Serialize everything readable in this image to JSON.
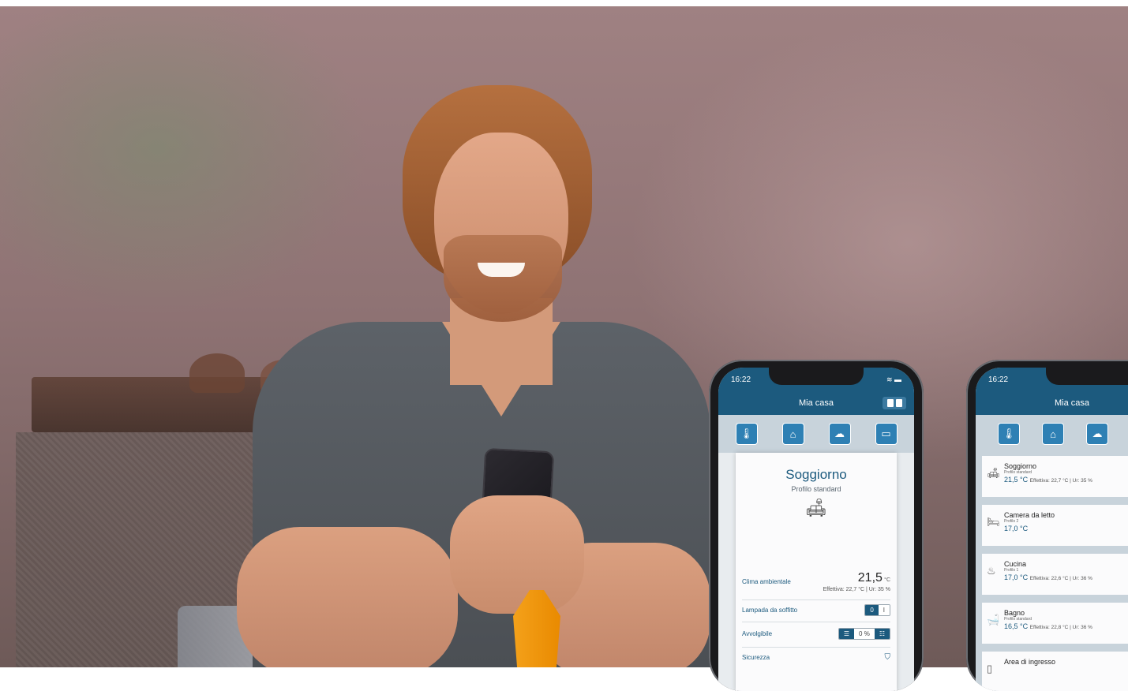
{
  "status_time": "16:22",
  "status_icons": "≋ ▬",
  "phone1": {
    "nav_title": "Mia casa",
    "room_title": "Soggiorno",
    "room_profile": "Profilo standard",
    "rows": {
      "clima_label": "Clima ambientale",
      "clima_value": "21,5",
      "clima_unit": "°C",
      "clima_effective": "Effettiva: 22,7 °C | Ur: 35 %",
      "lampada_label": "Lampada da soffitto",
      "lampada_off": "0",
      "lampada_on": "I",
      "avvolgibile_label": "Avvolgibile",
      "avvolgibile_value": "0 %",
      "sicurezza_label": "Sicurezza"
    }
  },
  "phone2": {
    "nav_title": "Mia casa",
    "rooms": [
      {
        "name": "Soggiorno",
        "profile": "Profilo standard",
        "temp": "21,5 °C",
        "effective": "Effettiva: 22,7 °C | Ur: 35 %"
      },
      {
        "name": "Camera da letto",
        "profile": "Profilo 2",
        "temp": "17,0 °C",
        "effective": ""
      },
      {
        "name": "Cucina",
        "profile": "Profilo 1",
        "temp": "17,0 °C",
        "effective": "Effettiva: 22,6 °C | Ur: 36 %"
      },
      {
        "name": "Bagno",
        "profile": "Profilo standard",
        "temp": "16,5 °C",
        "effective": "Effettiva: 22,8 °C | Ur: 36 %"
      },
      {
        "name": "Area di ingresso",
        "profile": "",
        "temp": "",
        "effective": ""
      }
    ]
  },
  "icons": {
    "thermometer": "thermometer-icon",
    "house": "house-icon",
    "cloud": "cloud-icon",
    "window": "window-icon",
    "sofa": "sofa-icon",
    "bed": "bed-icon",
    "cooking": "cooking-pot-icon",
    "bath": "bathtub-icon",
    "door": "door-icon",
    "shield": "shield-icon"
  },
  "colors": {
    "accent": "#1c5a7e",
    "button": "#2e80b4"
  }
}
